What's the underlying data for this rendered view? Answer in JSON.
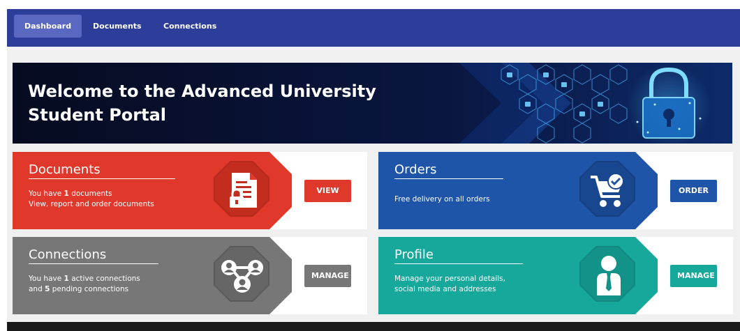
{
  "nav": {
    "items": [
      {
        "label": "Dashboard",
        "active": true
      },
      {
        "label": "Documents",
        "active": false
      },
      {
        "label": "Connections",
        "active": false
      }
    ]
  },
  "banner": {
    "title_line1": "Welcome to the Advanced University",
    "title_line2": "Student Portal"
  },
  "cards": {
    "documents": {
      "title": "Documents",
      "line1_pre": "You have ",
      "line1_count": "1",
      "line1_post": " documents",
      "line2": "View, report and order documents",
      "button": "VIEW",
      "icon": "document-lock-icon",
      "color": "#e0392b"
    },
    "orders": {
      "title": "Orders",
      "line1": "Free delivery on all orders",
      "button": "ORDER",
      "icon": "cart-check-icon",
      "color": "#1f55a8"
    },
    "connections": {
      "title": "Connections",
      "line1_pre": "You have ",
      "line1_count": "1",
      "line1_post": " active connections",
      "line2_pre": "and ",
      "line2_count": "5",
      "line2_post": " pending connections",
      "button": "MANAGE",
      "icon": "people-network-icon",
      "color": "#777777"
    },
    "profile": {
      "title": "Profile",
      "line1": "Manage your personal details,",
      "line2": "social media and addresses",
      "button": "MANAGE",
      "icon": "user-icon",
      "color": "#17a89c"
    }
  }
}
